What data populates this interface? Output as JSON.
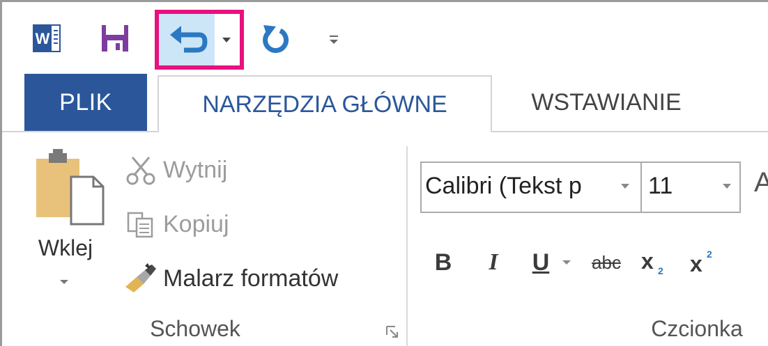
{
  "quick_access": {
    "word_icon": "word-app-icon",
    "word_letter": "W",
    "save_icon": "floppy-disk-icon",
    "undo_icon": "undo-arrow-icon",
    "undo_dropdown_icon": "chevron-down-icon",
    "redo_icon": "redo-arrow-icon",
    "customize_icon": "customize-toolbar-icon",
    "highlight_color": "#e8117f",
    "save_color": "#7e3d9e",
    "undo_color": "#2b79c2"
  },
  "tabs": [
    {
      "label": "PLIK",
      "active": false,
      "accent": "#2b579a"
    },
    {
      "label": "NARZĘDZIA GŁÓWNE",
      "active": true
    },
    {
      "label": "WSTAWIANIE",
      "active": false
    }
  ],
  "clipboard": {
    "paste_label": "Wklej",
    "cut_label": "Wytnij",
    "copy_label": "Kopiuj",
    "format_painter_label": "Malarz formatów",
    "group_label": "Schowek",
    "cut_enabled": false,
    "copy_enabled": false
  },
  "font": {
    "font_name": "Calibri (Tekst p",
    "font_size": "11",
    "grow_font_glyph": "A",
    "bold": "B",
    "italic": "I",
    "underline": "U",
    "strikethrough": "abc",
    "subscript": "x₂",
    "superscript": "x²",
    "group_label": "Czcionka"
  }
}
